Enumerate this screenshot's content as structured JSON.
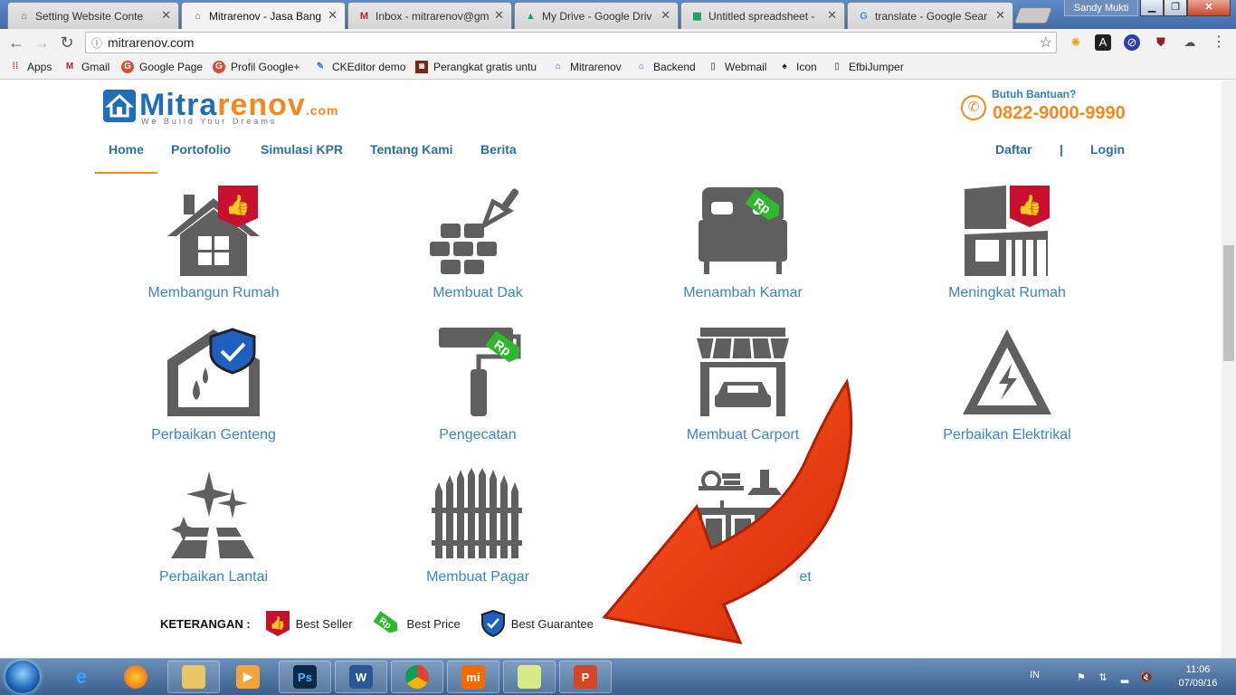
{
  "tabs": [
    {
      "title": "Setting Website Conte",
      "icon": "mitrarenov-favicon"
    },
    {
      "title": "Mitrarenov - Jasa Bang",
      "icon": "mitrarenov-favicon",
      "active": true
    },
    {
      "title": "Inbox - mitrarenov@gm",
      "icon": "gmail-icon"
    },
    {
      "title": "My Drive - Google Driv",
      "icon": "google-drive-icon"
    },
    {
      "title": "Untitled spreadsheet - ",
      "icon": "google-sheets-icon"
    },
    {
      "title": "translate - Google Sear",
      "icon": "google-icon"
    }
  ],
  "window": {
    "profile": "Sandy Mukti"
  },
  "toolbar": {
    "url": "mitrarenov.com"
  },
  "bookmarks": [
    {
      "label": "Apps",
      "icon": "apps-grid-icon"
    },
    {
      "label": "Gmail",
      "icon": "gmail-icon"
    },
    {
      "label": "Google Page",
      "icon": "google-plus-icon"
    },
    {
      "label": "Profil Google+",
      "icon": "google-plus-icon"
    },
    {
      "label": "CKEditor demo",
      "icon": "ckeditor-icon"
    },
    {
      "label": "Perangkat gratis untu",
      "icon": "tool-icon"
    },
    {
      "label": "Mitrarenov",
      "icon": "mitrarenov-favicon"
    },
    {
      "label": "Backend",
      "icon": "mitrarenov-favicon"
    },
    {
      "label": "Webmail",
      "icon": "page-icon"
    },
    {
      "label": "Icon",
      "icon": "icon-bookmark-icon"
    },
    {
      "label": "EfbiJumper",
      "icon": "page-icon"
    }
  ],
  "site": {
    "logo_main": "Mitra",
    "logo_accent": "renov",
    "logo_suffix": ".com",
    "tagline": "We Build Your Dreams",
    "help_label": "Butuh Bantuan?",
    "phone": "0822-9000-9990",
    "menu": [
      "Home",
      "Portofolio",
      "Simulasi KPR",
      "Tentang Kami",
      "Berita"
    ],
    "auth": {
      "register": "Daftar",
      "separator": "|",
      "login": "Login"
    }
  },
  "services": [
    "Membangun Rumah",
    "Membuat Dak",
    "Menambah Kamar",
    "Meningkat Rumah",
    "Perbaikan Genteng",
    "Pengecatan",
    "Membuat Carport",
    "Perbaikan Elektrikal",
    "Perbaikan Lantai",
    "Membuat Pagar",
    "et"
  ],
  "legend": {
    "title": "KETERANGAN :",
    "best_seller": "Best Seller",
    "best_price": "Best Price",
    "best_guarantee": "Best Guarantee",
    "price_tag_text": "Rp"
  },
  "taskbar": {
    "lang": "IN",
    "time": "11:06",
    "date": "07/09/16"
  },
  "colors": {
    "brand_blue": "#1e6fb8",
    "brand_orange": "#f28a1f",
    "link_blue": "#3a86c5",
    "icon_gray": "#5f5f5f",
    "badge_red": "#c8102e",
    "badge_green": "#2db82d",
    "arrow_red": "#e8380d"
  }
}
